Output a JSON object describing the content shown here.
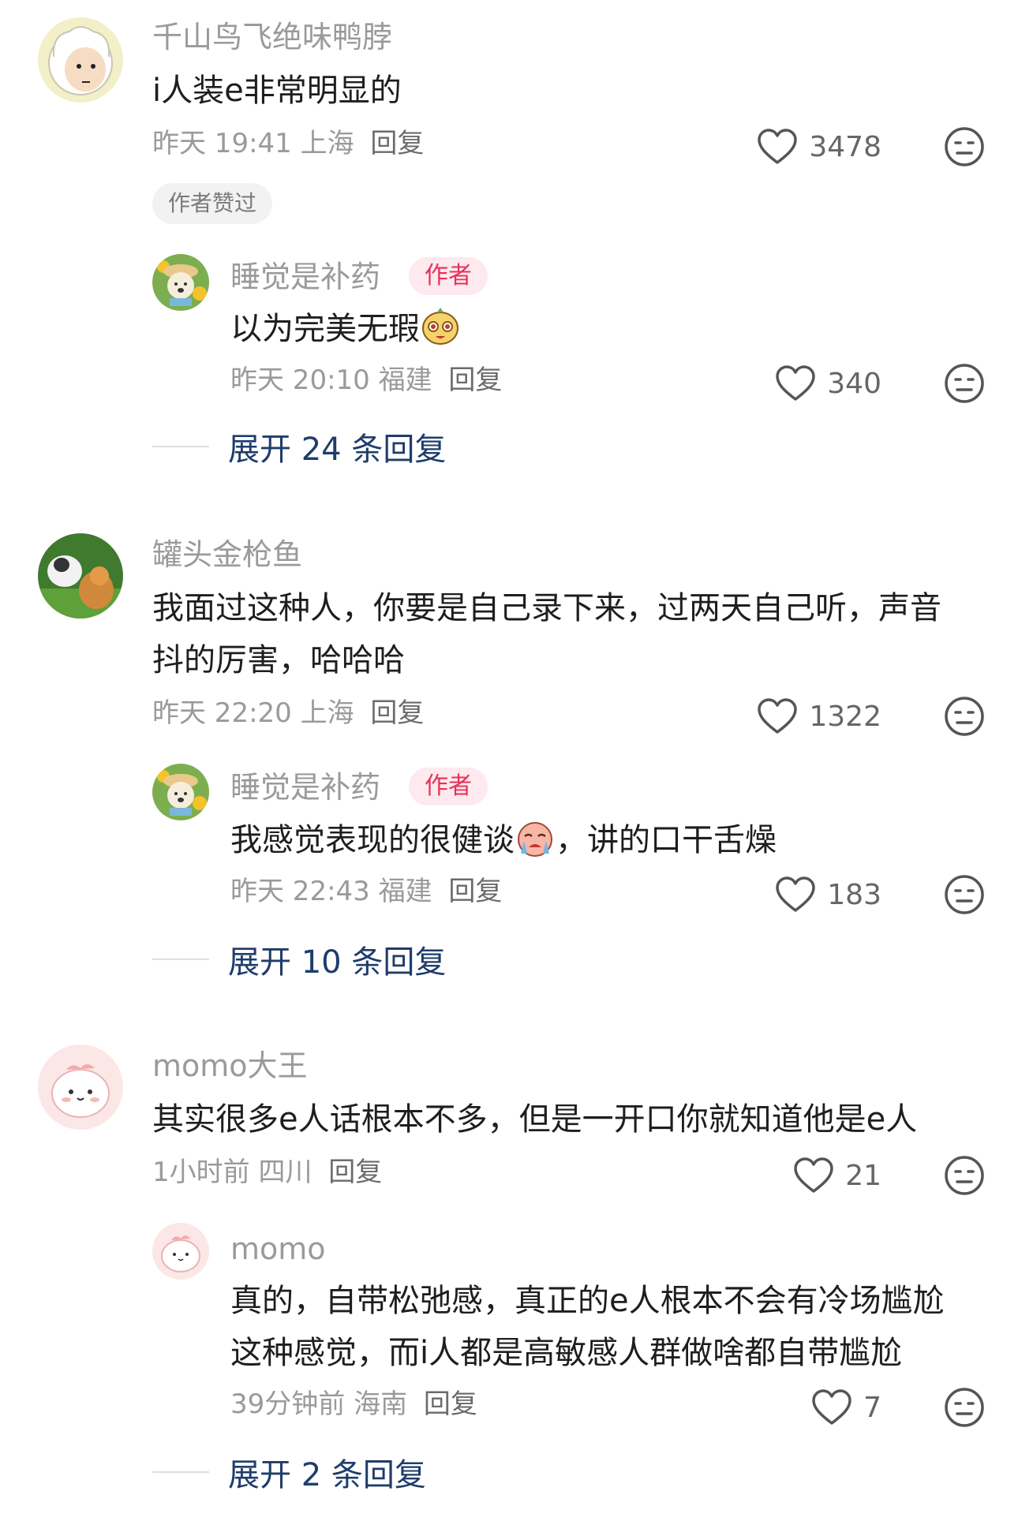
{
  "comments": [
    {
      "username": "千山鸟飞绝味鸭脖",
      "text": "i人装e非常明显的",
      "time": "昨天 19:41",
      "location": "上海",
      "reply_label": "回复",
      "likes": "3478",
      "badge": "作者赞过",
      "avatar_icon": "sheep-cartoon-avatar",
      "sub_reply": {
        "username": "睡觉是补药",
        "tag": "作者",
        "text": "以为完美无瑕",
        "emoji": "smiling-face-emoji",
        "time": "昨天 20:10",
        "location": "福建",
        "reply_label": "回复",
        "likes": "340",
        "avatar_icon": "bear-sunflower-avatar"
      },
      "expand_label": "展开 24 条回复"
    },
    {
      "username": "罐头金枪鱼",
      "text_line1": "我面过这种人，你要是自己录下来，过两天自己听，声音",
      "text_line2": "抖的厉害，哈哈哈",
      "time": "昨天 22:20",
      "location": "上海",
      "reply_label": "回复",
      "likes": "1322",
      "avatar_icon": "cat-and-dog-avatar",
      "sub_reply": {
        "username": "睡觉是补药",
        "tag": "作者",
        "text_before": "我感觉表现的很健谈",
        "text_after": "，讲的口干舌燥",
        "emoji": "crying-face-emoji",
        "time": "昨天 22:43",
        "location": "福建",
        "reply_label": "回复",
        "likes": "183",
        "avatar_icon": "bear-sunflower-avatar"
      },
      "expand_label": "展开 10 条回复"
    },
    {
      "username": "momo大王",
      "text": "其实很多e人话根本不多，但是一开口你就知道他是e人",
      "time": "1小时前",
      "location": "四川",
      "reply_label": "回复",
      "likes": "21",
      "avatar_icon": "pink-blob-avatar",
      "sub_reply": {
        "username": "momo",
        "text_line1": "真的，自带松弛感，真正的e人根本不会有冷场尴尬",
        "text_line2": "这种感觉，而i人都是高敏感人群做啥都自带尴尬",
        "time": "39分钟前",
        "location": "海南",
        "reply_label": "回复",
        "likes": "7",
        "avatar_icon": "pink-blob-avatar"
      },
      "expand_label": "展开 2 条回复"
    }
  ],
  "colors": {
    "username": "#9a9a9a",
    "content": "#1e1e1e",
    "expand_link": "#1f3d6b",
    "author_tag_text": "#e5325a",
    "author_tag_bg": "#fde9ee"
  }
}
